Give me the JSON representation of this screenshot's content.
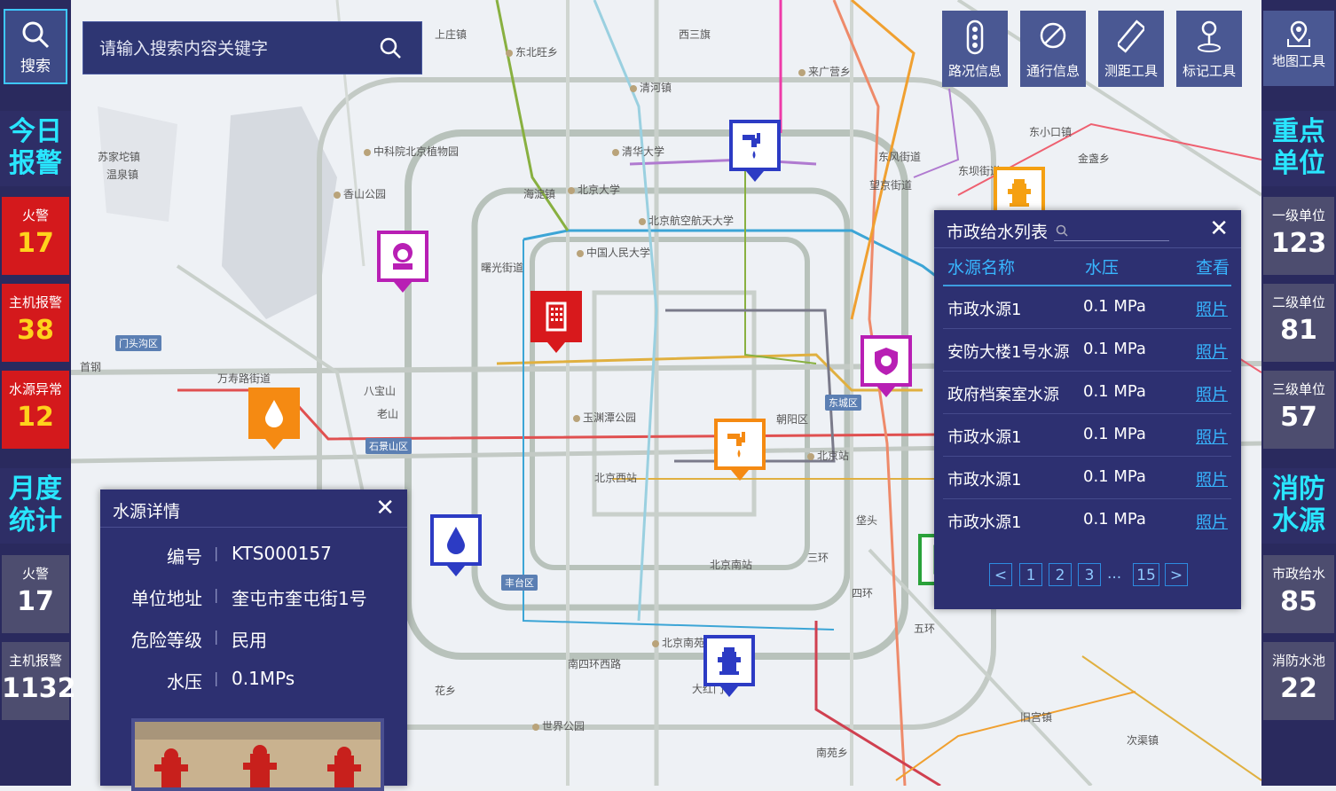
{
  "left_sidebar": {
    "search_label": "搜索",
    "today_title": "今日报警",
    "today_stats": [
      {
        "label": "火警",
        "value": "17"
      },
      {
        "label": "主机报警",
        "value": "38"
      },
      {
        "label": "水源异常",
        "value": "12"
      }
    ],
    "month_title": "月度统计",
    "month_stats": [
      {
        "label": "火警",
        "value": "17"
      },
      {
        "label": "主机报警",
        "value": "1132"
      }
    ]
  },
  "right_sidebar": {
    "map_tools_label": "地图工具",
    "key_units_title": "重点单位",
    "key_units": [
      {
        "label": "一级单位",
        "value": "123"
      },
      {
        "label": "二级单位",
        "value": "81"
      },
      {
        "label": "三级单位",
        "value": "57"
      }
    ],
    "fire_water_title": "消防水源",
    "fire_water": [
      {
        "label": "市政给水",
        "value": "85"
      },
      {
        "label": "消防水池",
        "value": "22"
      }
    ]
  },
  "search": {
    "placeholder": "请输入搜索内容关键字"
  },
  "toolbar": [
    {
      "label": "路况信息",
      "icon": "traffic-light-icon"
    },
    {
      "label": "通行信息",
      "icon": "no-entry-icon"
    },
    {
      "label": "测距工具",
      "icon": "ruler-icon"
    },
    {
      "label": "标记工具",
      "icon": "pin-icon"
    }
  ],
  "water_list": {
    "title": "市政给水列表",
    "columns": [
      "水源名称",
      "水压",
      "查看"
    ],
    "rows": [
      {
        "name": "市政水源1",
        "pressure": "0.1 MPa",
        "link": "照片"
      },
      {
        "name": "安防大楼1号水源",
        "pressure": "0.1 MPa",
        "link": "照片"
      },
      {
        "name": "政府档案室水源",
        "pressure": "0.1 MPa",
        "link": "照片"
      },
      {
        "name": "市政水源1",
        "pressure": "0.1 MPa",
        "link": "照片"
      },
      {
        "name": "市政水源1",
        "pressure": "0.1 MPa",
        "link": "照片"
      },
      {
        "name": "市政水源1",
        "pressure": "0.1 MPa",
        "link": "照片"
      }
    ],
    "pagination": {
      "prev": "<",
      "pages": [
        "1",
        "2",
        "3"
      ],
      "ellipsis": "...",
      "last": "15",
      "next": ">"
    }
  },
  "water_detail": {
    "title": "水源详情",
    "fields": [
      {
        "key": "编号",
        "value": "KTS000157"
      },
      {
        "key": "单位地址",
        "value": "奎屯市奎屯街1号"
      },
      {
        "key": "危险等级",
        "value": "民用"
      },
      {
        "key": "水压",
        "value": "0.1MPs"
      }
    ]
  },
  "map_labels": [
    "东北旺乡",
    "清河镇",
    "来广营乡",
    "清华大学",
    "北京大学",
    "海淀镇",
    "北京航空航天大学",
    "中国人民大学",
    "香山公园",
    "中科院北京植物园",
    "曙光街道",
    "万寿路街道",
    "八宝山",
    "老山",
    "石景山区",
    "玉渊潭公园",
    "北京西站",
    "北京南站",
    "丰台区",
    "南四环西路",
    "北京南苑机场",
    "世界公园",
    "东城区",
    "朝阳区",
    "望京街道",
    "东坝街道",
    "东风街道",
    "垡头",
    "金盏乡",
    "北京站",
    "大红门",
    "花乡",
    "南苑乡",
    "旧宫镇",
    "次渠镇",
    "东小口镇",
    "西三旗",
    "上庄镇",
    "苏家坨镇",
    "温泉镇",
    "门头沟区",
    "首钢",
    "三环",
    "四环",
    "五环"
  ]
}
